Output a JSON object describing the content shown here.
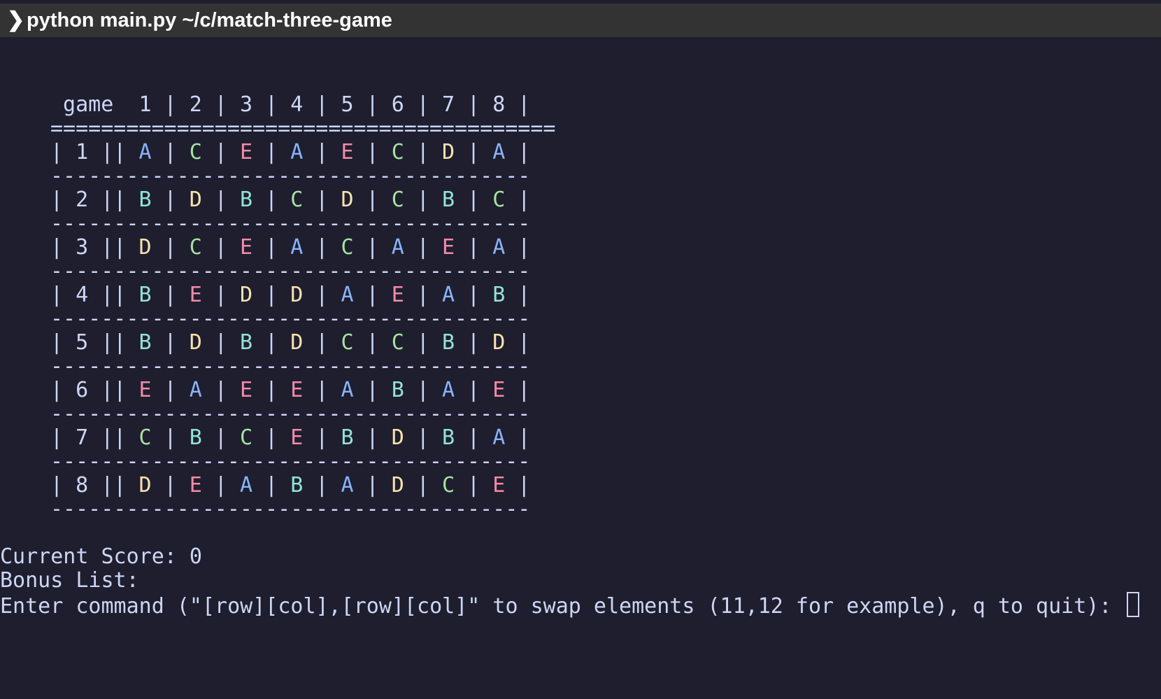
{
  "titlebar": {
    "prompt_icon": "chevron-right-icon",
    "prompt_glyph": "❯",
    "command": "python main.py ~/c/match-three-game"
  },
  "board": {
    "header_label": "game",
    "columns": [
      "1",
      "2",
      "3",
      "4",
      "5",
      "6",
      "7",
      "8"
    ],
    "separator": "========================================",
    "row_divider": "--------------------------------------",
    "rows": [
      {
        "label": "1",
        "cells": [
          "A",
          "C",
          "E",
          "A",
          "E",
          "C",
          "D",
          "A"
        ]
      },
      {
        "label": "2",
        "cells": [
          "B",
          "D",
          "B",
          "C",
          "D",
          "C",
          "B",
          "C"
        ]
      },
      {
        "label": "3",
        "cells": [
          "D",
          "C",
          "E",
          "A",
          "C",
          "A",
          "E",
          "A"
        ]
      },
      {
        "label": "4",
        "cells": [
          "B",
          "E",
          "D",
          "D",
          "A",
          "E",
          "A",
          "B"
        ]
      },
      {
        "label": "5",
        "cells": [
          "B",
          "D",
          "B",
          "D",
          "C",
          "C",
          "B",
          "D"
        ]
      },
      {
        "label": "6",
        "cells": [
          "E",
          "A",
          "E",
          "E",
          "A",
          "B",
          "A",
          "E"
        ]
      },
      {
        "label": "7",
        "cells": [
          "C",
          "B",
          "C",
          "E",
          "B",
          "D",
          "B",
          "A"
        ]
      },
      {
        "label": "8",
        "cells": [
          "D",
          "E",
          "A",
          "B",
          "A",
          "D",
          "C",
          "E"
        ]
      }
    ],
    "symbol_colors": {
      "A": "#89b4fa",
      "B": "#94e2d5",
      "C": "#a6e3a1",
      "D": "#f9e2af",
      "E": "#f38ba8"
    }
  },
  "status": {
    "score_line": "Current Score: 0",
    "bonus_line": "Bonus List:",
    "prompt_line": "Enter command (\"[row][col],[row][col]\" to swap elements (11,12 for example), q to quit): "
  },
  "colors": {
    "background": "#1e1e2e",
    "titlebar": "#333333",
    "foreground": "#cdd6f4"
  }
}
